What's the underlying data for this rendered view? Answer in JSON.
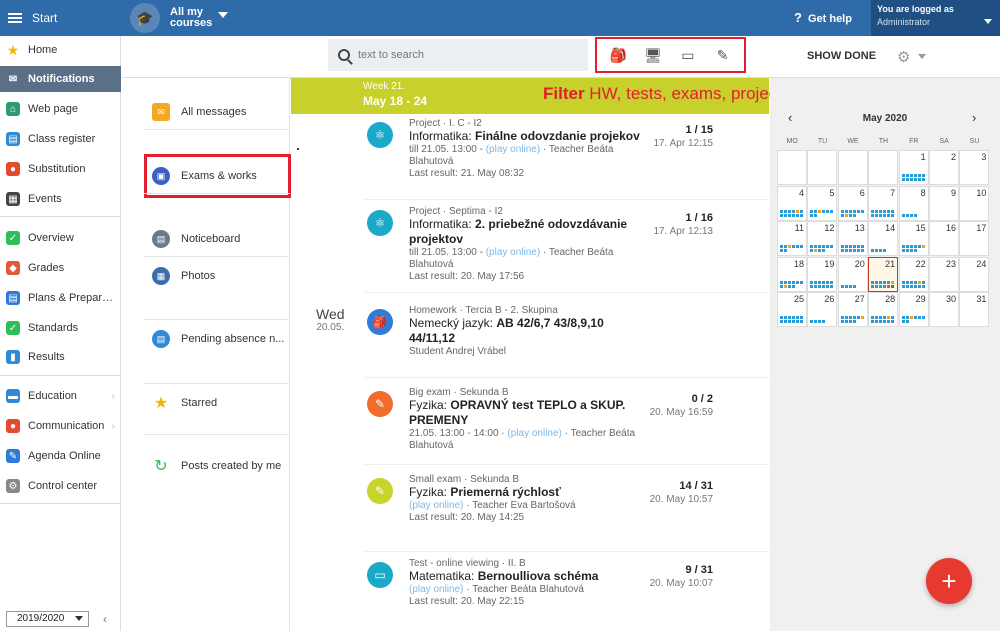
{
  "topbar": {
    "start_label": "Start",
    "courses_label": "All my courses",
    "help_label": "Get help",
    "user_line1": "You are logged as",
    "user_line2": "Administrator"
  },
  "sidebar": {
    "items": [
      {
        "label": "Home",
        "icon": "star-icon",
        "color": "#f5b400"
      },
      {
        "label": "Notifications",
        "icon": "envelope-icon",
        "color": "#ffffff"
      },
      {
        "label": "Web page",
        "icon": "house-icon",
        "color": "#2e9b6e"
      },
      {
        "label": "Class register",
        "icon": "register-icon",
        "color": "#2f8ad8"
      },
      {
        "label": "Substitution",
        "icon": "person-icon",
        "color": "#e34b2f"
      },
      {
        "label": "Events",
        "icon": "calendar-icon",
        "color": "#444444"
      },
      {
        "label": "Overview",
        "icon": "check-circle-icon",
        "color": "#2ebf5a"
      },
      {
        "label": "Grades",
        "icon": "grade-icon",
        "color": "#e3583a"
      },
      {
        "label": "Plans & Prepar…",
        "icon": "plans-icon",
        "color": "#2f7bd8"
      },
      {
        "label": "Standards",
        "icon": "shield-check-icon",
        "color": "#2ebf5a"
      },
      {
        "label": "Results",
        "icon": "bar-chart-icon",
        "color": "#2f8ad8"
      },
      {
        "label": "Education",
        "icon": "book-icon",
        "color": "#2f8ad8"
      },
      {
        "label": "Communication",
        "icon": "chat-icon",
        "color": "#e34b2f"
      },
      {
        "label": "Agenda Online",
        "icon": "pencil-icon",
        "color": "#2f7bd8"
      },
      {
        "label": "Control center",
        "icon": "gear-icon",
        "color": "#888888"
      }
    ],
    "school_year": "2019/2020"
  },
  "toolbar": {
    "search_placeholder": "text to search",
    "filter_icons": [
      "homework-filter-icon",
      "test-filter-icon",
      "exam-filter-icon",
      "project-filter-icon"
    ],
    "show_done_label": "SHOW DONE"
  },
  "folders": [
    {
      "label": "All messages",
      "icon": "envelope-icon",
      "color": "#f5a623"
    },
    {
      "label": "Exams & works",
      "icon": "exams-icon",
      "color": "#3b5fc7"
    },
    {
      "label": "Noticeboard",
      "icon": "noticeboard-icon",
      "color": "#6b7b8c"
    },
    {
      "label": "Photos",
      "icon": "photos-icon",
      "color": "#3b6ea8"
    },
    {
      "label": "Pending absence n...",
      "icon": "absence-icon",
      "color": "#2f8ad8"
    },
    {
      "label": "Starred",
      "icon": "star-icon",
      "color": "#f5b400"
    },
    {
      "label": "Posts created by me",
      "icon": "history-icon",
      "color": "#2ebf5a"
    }
  ],
  "week": {
    "label": "Week 21.",
    "range": "May 18 - 24"
  },
  "annotation": {
    "bold": "Filter",
    "rest": " HW, tests, exams, projects"
  },
  "day": {
    "weekday": "Wed",
    "date": "20.05."
  },
  "entries": [
    {
      "icon": "atom-icon",
      "color": "#1aa9c9",
      "meta": "Project · I. C - I2",
      "subject": "Informatika:",
      "title": "Finálne odovzdanie projekov",
      "line1_pre": "till 21.05. 13:00 - ",
      "line1_online": "(play online)",
      "line1_post": " · Teacher  Beáta Blahutová",
      "line2": "Last result: 21. May 08:32",
      "score": "1 / 15",
      "date": "17. Apr 12:15"
    },
    {
      "icon": "atom-icon",
      "color": "#1aa9c9",
      "meta": "Project · Septima - I2",
      "subject": "Informatika:",
      "title": "2. priebežné odovzdávanie projektov",
      "line1_pre": "till 21.05. 13:00 - ",
      "line1_online": "(play online)",
      "line1_post": " · Teacher  Beáta Blahutová",
      "line2": "Last result: 20. May 17:56",
      "score": "1 / 16",
      "date": "17. Apr 12:13"
    },
    {
      "icon": "backpack-icon",
      "color": "#2f7bd8",
      "meta": "Homework · Tercia B - 2. Skupina",
      "subject": "Nemecký jazyk:",
      "title": "AB 42/6,7 43/8,9,10 44/11,12",
      "line1_pre": "Student Andrej Vrábel",
      "line1_online": "",
      "line1_post": "",
      "line2": "",
      "score": "",
      "date": ""
    },
    {
      "icon": "exam-sheet-icon",
      "color": "#f06d2c",
      "meta": "Big exam · Sekunda B",
      "subject": "Fyzika:",
      "title": "OPRAVNÝ test TEPLO a SKUP. PREMENY",
      "line1_pre": "21.05. 13:00 - 14:00 · ",
      "line1_online": "(play online)",
      "line1_post": " · Teacher Beáta Blahutová",
      "line2": "",
      "score": "0 / 2",
      "date": "20. May 16:59"
    },
    {
      "icon": "small-exam-icon",
      "color": "#c6d42c",
      "meta": "Small exam · Sekunda B",
      "subject": "Fyzika:",
      "title": "Priemerná rýchlosť",
      "line1_pre": "",
      "line1_online": "(play online)",
      "line1_post": " · Teacher  Eva Bartošová",
      "line2": "Last result: 20. May 14:25",
      "score": "14 / 31",
      "date": "20. May 10:57"
    },
    {
      "icon": "screen-test-icon",
      "color": "#1aa9c9",
      "meta": "Test - online viewing · II. B",
      "subject": "Matematika:",
      "title": "Bernoulliova schéma",
      "line1_pre": "",
      "line1_online": "(play online)",
      "line1_post": " · Teacher Beáta Blahutová",
      "line2": "Last result: 20. May 22:15",
      "score": "9 / 31",
      "date": "20. May 10:07"
    }
  ],
  "calendar": {
    "month": "May 2020",
    "prev": "‹",
    "next": "›",
    "weekdays": [
      "MO",
      "TU",
      "WE",
      "TH",
      "FR",
      "SA",
      "SU"
    ],
    "weeks": [
      [
        "",
        "",
        "",
        "",
        "1",
        "2",
        "3"
      ],
      [
        "4",
        "5",
        "6",
        "7",
        "8",
        "9",
        "10"
      ],
      [
        "11",
        "12",
        "13",
        "14",
        "15",
        "16",
        "17"
      ],
      [
        "18",
        "19",
        "20",
        "21",
        "22",
        "23",
        "24"
      ],
      [
        "25",
        "26",
        "27",
        "28",
        "29",
        "30",
        "31"
      ]
    ],
    "today": "21"
  },
  "fab_label": "+"
}
